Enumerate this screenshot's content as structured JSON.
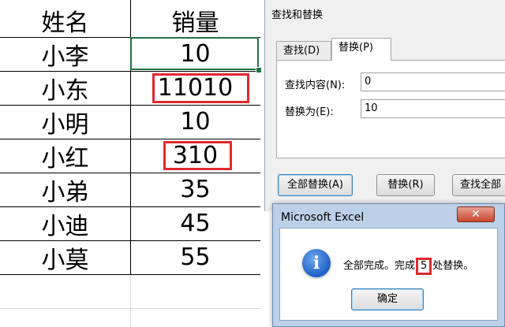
{
  "sheet": {
    "header": {
      "name": "姓名",
      "value": "销量"
    },
    "rows": [
      {
        "name": "小李",
        "value": "10"
      },
      {
        "name": "小东",
        "value": "11010"
      },
      {
        "name": "小明",
        "value": "10"
      },
      {
        "name": "小红",
        "value": "310"
      },
      {
        "name": "小弟",
        "value": "35"
      },
      {
        "name": "小迪",
        "value": "45"
      },
      {
        "name": "小莫",
        "value": "55"
      }
    ]
  },
  "find_replace": {
    "title": "查找和替换",
    "tabs": [
      "查找(D)",
      "替换(P)"
    ],
    "active_tab": "替换(P)",
    "find_label": "查找内容(N):",
    "find_value": "0",
    "replace_label": "替换为(E):",
    "replace_value": "10",
    "buttons": {
      "replace_all": "全部替换(A)",
      "replace": "替换(R)",
      "find_all": "查找全部"
    }
  },
  "message_box": {
    "title": "Microsoft Excel",
    "close_glyph": "✕",
    "icon": "info-icon",
    "text_before": "全部完成。完成",
    "count": "5",
    "text_after": "处替换。",
    "ok_label": "确定"
  },
  "colors": {
    "highlight": "#e0292e",
    "selection": "#217346"
  }
}
